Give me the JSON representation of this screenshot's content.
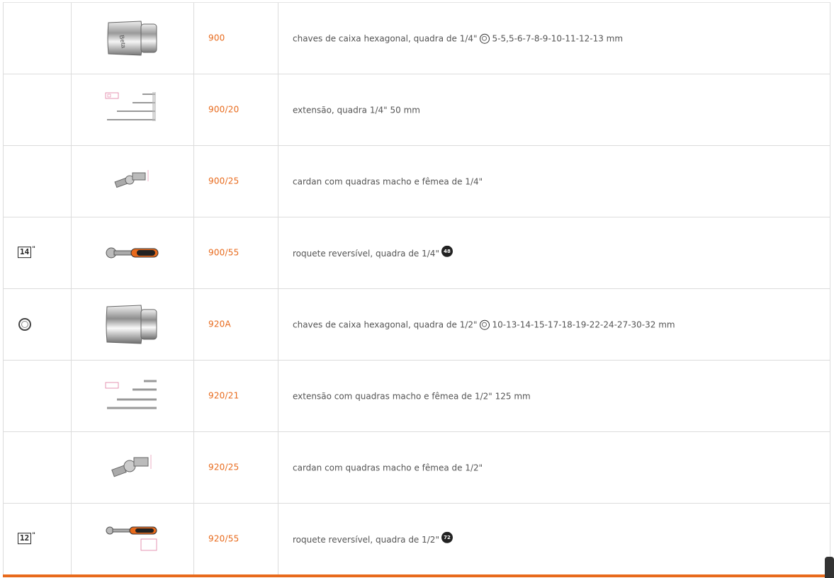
{
  "accent_color": "#e86a1c",
  "rows": [
    {
      "symbol": "",
      "image": "socket-1-4-icon",
      "code": "900",
      "desc": "chaves de caixa hexagonal, quadra de 1/4\"",
      "desc_icon": "ring-icon",
      "desc_suffix": "5-5,5-6-7-8-9-10-11-12-13 mm"
    },
    {
      "symbol": "",
      "image": "extension-bars-icon",
      "code": "900/20",
      "desc": "extensão, quadra 1/4\" 50 mm",
      "desc_icon": "",
      "desc_suffix": ""
    },
    {
      "symbol": "",
      "image": "universal-joint-icon",
      "code": "900/25",
      "desc": "cardan com quadras macho e fêmea de 1/4\"",
      "desc_icon": "",
      "desc_suffix": ""
    },
    {
      "symbol": "14",
      "image": "ratchet-icon",
      "code": "900/55",
      "desc": "roquete reversível, quadra de 1/4\"",
      "desc_icon": "gear-48-icon",
      "desc_icon_text": "48",
      "desc_suffix": ""
    },
    {
      "symbol": "ring",
      "image": "socket-1-2-icon",
      "code": "920A",
      "desc": "chaves de caixa hexagonal, quadra de 1/2\"",
      "desc_icon": "ring-icon",
      "desc_suffix": "10-13-14-15-17-18-19-22-24-27-30-32 mm"
    },
    {
      "symbol": "",
      "image": "extension-bars-icon",
      "code": "920/21",
      "desc": "extensão com quadras macho e fêmea de 1/2\" 125 mm",
      "desc_icon": "",
      "desc_suffix": ""
    },
    {
      "symbol": "",
      "image": "universal-joint-icon",
      "code": "920/25",
      "desc": "cardan com quadras macho e fêmea de 1/2\"",
      "desc_icon": "",
      "desc_suffix": ""
    },
    {
      "symbol": "12",
      "image": "ratchet-icon",
      "code": "920/55",
      "desc": "roquete reversível, quadra de 1/2\"",
      "desc_icon": "gear-72-icon",
      "desc_icon_text": "72",
      "desc_suffix": ""
    }
  ],
  "symbol_quote": "\""
}
